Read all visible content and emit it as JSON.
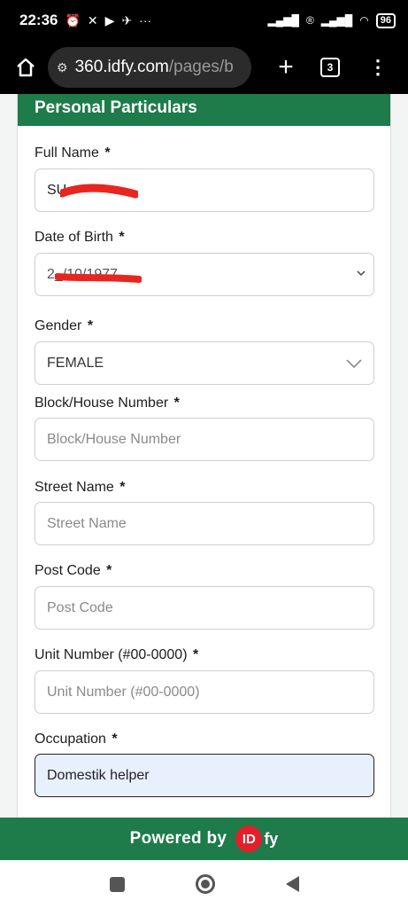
{
  "status_bar": {
    "time": "22:36",
    "battery": "96"
  },
  "browser": {
    "url_host": "360.idfy.com",
    "url_path": "/pages/b",
    "tab_count": "3"
  },
  "form": {
    "section_title": "Personal Particulars",
    "required_mark": "*",
    "fields": [
      {
        "label": "Full Name",
        "value": "SU",
        "placeholder": ""
      },
      {
        "label": "Date of Birth",
        "value": "2_/10/1977",
        "placeholder": ""
      },
      {
        "label": "Gender",
        "value": "FEMALE",
        "placeholder": ""
      },
      {
        "label": "Block/House Number",
        "value": "",
        "placeholder": "Block/House Number"
      },
      {
        "label": "Street Name",
        "value": "",
        "placeholder": "Street Name"
      },
      {
        "label": "Post Code",
        "value": "",
        "placeholder": "Post Code"
      },
      {
        "label": "Unit Number (#00-0000)",
        "value": "",
        "placeholder": "Unit Number (#00-0000)"
      },
      {
        "label": "Occupation",
        "value": "Domestik helper",
        "placeholder": ""
      }
    ]
  },
  "footer": {
    "powered_by": "Powered by",
    "logo_id": "ID",
    "logo_fy": "fy"
  },
  "icons": {
    "home": "home-icon",
    "site_info": "site-info-icon",
    "new_tab": "plus-icon",
    "menu": "kebab-menu-icon",
    "chevron": "chevron-down-icon"
  },
  "colors": {
    "brand_green": "#1e7b4a",
    "idfy_red": "#e2202c",
    "redaction": "#e8261f",
    "occupation_fill": "#e8f0fe"
  }
}
